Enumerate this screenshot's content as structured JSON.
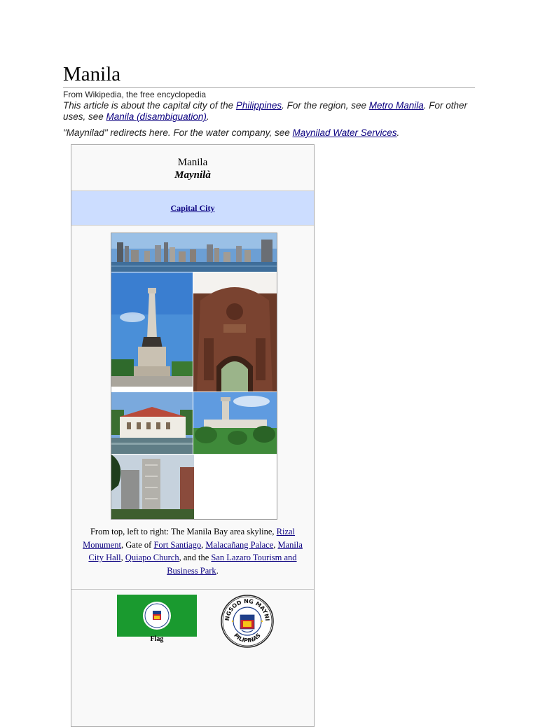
{
  "article": {
    "title": "Manila",
    "tagline": "From Wikipedia, the free encyclopedia",
    "hatnote1": {
      "part1": "This article is about the capital city of the ",
      "link1": "Philippines",
      "part2": ". For the region, see ",
      "link2": "Metro Manila",
      "part3": ". For other uses, see ",
      "link3": "Manila (disambiguation)",
      "part4": "."
    },
    "hatnote2": {
      "part1": "\"Maynilad\" redirects here. For the water company, see ",
      "link1": "Maynilad Water Services",
      "part2": "."
    }
  },
  "infobox": {
    "name": "Manila",
    "native_name": "Maynilà",
    "settlement_type": "Capital City",
    "caption": {
      "t1": "From top, left to right: The Manila Bay area skyline, ",
      "l1": "Rizal Monument",
      "t2": ", Gate of ",
      "l2": "Fort Santiago",
      "t3": ", ",
      "l3": "Malacañang Palace",
      "t4": ", ",
      "l4": "Manila City Hall",
      "t5": ", ",
      "l5": "Quiapo Church",
      "t6": ", and the ",
      "l6": "San Lazaro Tourism and Business Park",
      "t7": "."
    },
    "flag_label": "Flag",
    "seal_text_top": "LUNGSOD NG MAYNILA",
    "seal_text_bottom": "PILIPINAS"
  },
  "colors": {
    "link": "#0b0080",
    "infobox_header_bg": "#ccddff",
    "infobox_bg": "#f9f9f9",
    "flag_green": "#1a9a2f"
  }
}
